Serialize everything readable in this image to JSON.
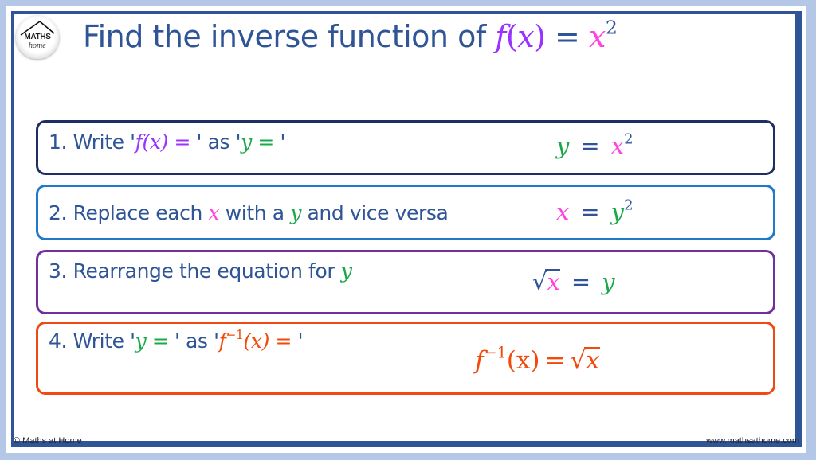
{
  "logo": {
    "line1": "MATHS",
    "line2": "home",
    "icon": "house-roof-icon"
  },
  "title": {
    "text": "Find the inverse function of ",
    "f": "f",
    "paren_open": "(",
    "x": "x",
    "paren_close": ")",
    "equals": " = ",
    "rhs_base": "x",
    "rhs_exp": "2"
  },
  "steps": [
    {
      "number": "1.",
      "label_parts": [
        "Write '",
        "f(x) =",
        " ' as '",
        "y =",
        " '"
      ],
      "equation": {
        "lhs": "y",
        "op": "=",
        "rhs_base": "x",
        "rhs_exp": "2"
      },
      "border_color": "#1f2f63"
    },
    {
      "number": "2.",
      "label_parts": [
        "Replace each ",
        "x",
        " with a ",
        "y",
        " and vice versa"
      ],
      "equation": {
        "lhs": "x",
        "op": "=",
        "rhs_base": "y",
        "rhs_exp": "2"
      },
      "border_color": "#1f7ac9"
    },
    {
      "number": "3.",
      "label_parts": [
        "Rearrange the equation for ",
        "y"
      ],
      "equation": {
        "lhs_radical": "√",
        "lhs_radicand": "x",
        "op": "=",
        "rhs": "y"
      },
      "border_color": "#7030a0"
    },
    {
      "number": "4.",
      "label_parts": [
        "Write '",
        "y =",
        " ' as '",
        "f",
        "−1",
        "(x) =",
        " '"
      ],
      "equation": {
        "f": "f",
        "exp": "−1",
        "arg": "(x)",
        "op": "=",
        "radical": "√",
        "radicand": "x"
      },
      "border_color": "#f04a14"
    }
  ],
  "colors": {
    "title": "#2f5597",
    "f_of_x": "#9933ff",
    "x_var": "#ff44dd",
    "y_var": "#1aa84a",
    "inverse": "#f24a0a",
    "frame": "#2f5597",
    "background": "#b4c7e7"
  },
  "footer": {
    "copyright": "© Maths at Home",
    "website": "www.mathsathome.com"
  }
}
